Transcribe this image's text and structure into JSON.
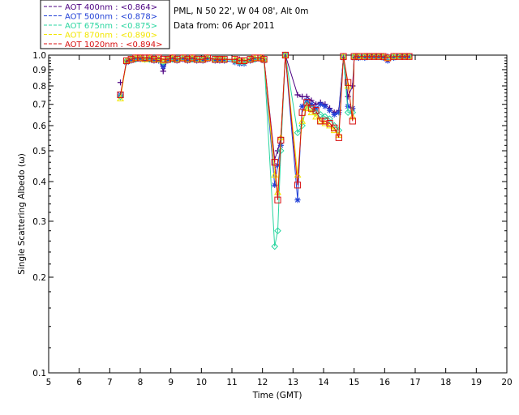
{
  "header": {
    "site_line": "PML, N 50 22', W 04 08', Alt 0m",
    "date_line": "Data from: 06 Apr 2011"
  },
  "legend": [
    {
      "label": "AOT  400nm : <0.864>",
      "color": "#4b0082",
      "marker": "plus"
    },
    {
      "label": "AOT  500nm : <0.878>",
      "color": "#1f3fd6",
      "marker": "asterisk"
    },
    {
      "label": "AOT  675nm : <0.875>",
      "color": "#2ad6a0",
      "marker": "diamond"
    },
    {
      "label": "AOT  870nm : <0.890>",
      "color": "#f2e600",
      "marker": "triangle"
    },
    {
      "label": "AOT 1020nm : <0.894>",
      "color": "#d81010",
      "marker": "square"
    }
  ],
  "chart_data": {
    "type": "line",
    "title": "",
    "xlabel": "Time (GMT)",
    "ylabel": "Single Scattering Albedo (ω)",
    "xlim": [
      5,
      20
    ],
    "ylim": [
      0.1,
      1.0
    ],
    "yscale": "log",
    "x_ticks": [
      "5",
      "6",
      "7",
      "8",
      "9",
      "10",
      "11",
      "12",
      "13",
      "14",
      "15",
      "16",
      "17",
      "18",
      "19",
      "20"
    ],
    "y_ticks": [
      "0.1",
      "0.2",
      "0.3",
      "0.4",
      "0.5",
      "0.6",
      "0.7",
      "0.8",
      "0.9",
      "1.0"
    ],
    "series": [
      {
        "name": "AOT  400nm : <0.864>",
        "color": "#4b0082",
        "x": [
          7.35,
          7.55,
          7.7,
          7.85,
          8.0,
          8.15,
          8.3,
          8.45,
          8.6,
          8.75,
          8.9,
          9.05,
          9.2,
          9.4,
          9.55,
          9.7,
          9.85,
          10.05,
          10.2,
          10.45,
          10.6,
          10.75,
          11.1,
          11.25,
          11.4,
          11.6,
          11.75,
          11.95,
          12.05,
          12.4,
          12.5,
          12.6,
          12.75,
          13.15,
          13.3,
          13.45,
          13.6,
          13.75,
          13.9,
          14.05,
          14.2,
          14.35,
          14.5,
          14.65,
          14.8,
          14.95,
          15.0,
          15.15,
          15.35,
          15.5,
          15.65,
          15.8,
          15.95,
          16.1,
          16.3,
          16.5,
          16.65,
          16.8
        ],
        "y": [
          0.82,
          0.96,
          0.97,
          0.98,
          0.98,
          0.97,
          0.98,
          0.97,
          0.97,
          0.89,
          0.97,
          0.98,
          0.97,
          0.98,
          0.97,
          0.98,
          0.97,
          0.97,
          0.98,
          0.97,
          0.97,
          0.97,
          0.97,
          0.97,
          0.96,
          0.97,
          0.98,
          0.98,
          0.97,
          0.47,
          0.5,
          0.55,
          1.0,
          0.75,
          0.74,
          0.74,
          0.72,
          0.7,
          0.71,
          0.7,
          0.68,
          0.66,
          0.67,
          0.98,
          0.74,
          0.8,
          0.98,
          0.98,
          0.99,
          0.99,
          0.99,
          0.99,
          0.99,
          0.99,
          0.99,
          0.99,
          0.99,
          0.99
        ],
        "gaps": [
          0
        ]
      },
      {
        "name": "AOT  500nm : <0.878>",
        "color": "#1f3fd6",
        "x": [
          7.35,
          7.55,
          7.7,
          7.85,
          8.0,
          8.15,
          8.3,
          8.45,
          8.6,
          8.75,
          8.9,
          9.05,
          9.2,
          9.4,
          9.55,
          9.7,
          9.85,
          10.05,
          10.2,
          10.45,
          10.6,
          10.75,
          11.1,
          11.25,
          11.4,
          11.6,
          11.75,
          11.95,
          12.05,
          12.4,
          12.5,
          12.6,
          12.75,
          13.15,
          13.3,
          13.45,
          13.6,
          13.75,
          13.9,
          14.05,
          14.2,
          14.35,
          14.5,
          14.65,
          14.8,
          14.95,
          15.0,
          15.15,
          15.35,
          15.5,
          15.65,
          15.8,
          15.95,
          16.1,
          16.3,
          16.5,
          16.65,
          16.8
        ],
        "y": [
          0.75,
          0.95,
          0.96,
          0.97,
          0.97,
          0.97,
          0.97,
          0.96,
          0.96,
          0.92,
          0.96,
          0.97,
          0.96,
          0.97,
          0.96,
          0.97,
          0.96,
          0.96,
          0.97,
          0.96,
          0.96,
          0.96,
          0.95,
          0.94,
          0.94,
          0.96,
          0.97,
          0.97,
          0.96,
          0.39,
          0.45,
          0.52,
          1.0,
          0.35,
          0.69,
          0.72,
          0.7,
          0.68,
          0.7,
          0.69,
          0.67,
          0.65,
          0.66,
          0.98,
          0.69,
          0.68,
          0.98,
          0.98,
          0.98,
          0.99,
          0.99,
          0.99,
          0.98,
          0.96,
          0.98,
          0.99,
          0.99,
          0.99
        ]
      },
      {
        "name": "AOT  675nm : <0.875>",
        "color": "#2ad6a0",
        "x": [
          7.35,
          7.55,
          7.7,
          7.85,
          8.0,
          8.15,
          8.3,
          8.45,
          8.6,
          8.75,
          8.9,
          9.05,
          9.2,
          9.4,
          9.55,
          9.7,
          9.85,
          10.05,
          10.2,
          10.45,
          10.6,
          10.75,
          11.1,
          11.25,
          11.4,
          11.6,
          11.75,
          11.95,
          12.05,
          12.4,
          12.5,
          12.6,
          12.75,
          13.15,
          13.3,
          13.45,
          13.6,
          13.75,
          13.9,
          14.05,
          14.2,
          14.35,
          14.5,
          14.65,
          14.8,
          14.95,
          15.0,
          15.15,
          15.35,
          15.5,
          15.65,
          15.8,
          15.95,
          16.1,
          16.3,
          16.5,
          16.65,
          16.8
        ],
        "y": [
          0.74,
          0.96,
          0.97,
          0.97,
          0.98,
          0.97,
          0.97,
          0.97,
          0.97,
          0.95,
          0.97,
          0.97,
          0.97,
          0.98,
          0.97,
          0.97,
          0.97,
          0.97,
          0.98,
          0.97,
          0.97,
          0.97,
          0.96,
          0.95,
          0.95,
          0.97,
          0.97,
          0.98,
          0.97,
          0.25,
          0.28,
          0.5,
          1.0,
          0.57,
          0.6,
          0.7,
          0.68,
          0.66,
          0.65,
          0.64,
          0.63,
          0.6,
          0.58,
          0.99,
          0.66,
          0.66,
          0.99,
          0.99,
          0.99,
          0.99,
          0.99,
          0.99,
          0.99,
          0.98,
          0.99,
          0.99,
          0.99,
          0.99
        ]
      },
      {
        "name": "AOT  870nm : <0.890>",
        "color": "#f2e600",
        "x": [
          7.35,
          7.55,
          7.7,
          7.85,
          8.0,
          8.15,
          8.3,
          8.45,
          8.6,
          8.75,
          8.9,
          9.05,
          9.2,
          9.4,
          9.55,
          9.7,
          9.85,
          10.05,
          10.2,
          10.45,
          10.6,
          10.75,
          11.1,
          11.25,
          11.4,
          11.6,
          11.75,
          11.95,
          12.05,
          12.4,
          12.5,
          12.6,
          12.75,
          13.15,
          13.3,
          13.45,
          13.6,
          13.75,
          13.9,
          14.05,
          14.2,
          14.35,
          14.5,
          14.65,
          14.8,
          14.95,
          15.0,
          15.15,
          15.35,
          15.5,
          15.65,
          15.8,
          15.95,
          16.1,
          16.3,
          16.5,
          16.65,
          16.8
        ],
        "y": [
          0.73,
          0.96,
          0.97,
          0.98,
          0.98,
          0.97,
          0.98,
          0.97,
          0.97,
          0.96,
          0.97,
          0.98,
          0.97,
          0.98,
          0.97,
          0.98,
          0.97,
          0.97,
          0.98,
          0.97,
          0.97,
          0.97,
          0.97,
          0.96,
          0.96,
          0.97,
          0.98,
          0.98,
          0.97,
          0.42,
          0.37,
          0.55,
          1.0,
          0.42,
          0.62,
          0.68,
          0.66,
          0.64,
          0.62,
          0.61,
          0.6,
          0.58,
          0.56,
          0.99,
          0.8,
          0.64,
          0.99,
          0.99,
          0.99,
          0.99,
          0.99,
          0.99,
          0.99,
          0.98,
          0.99,
          0.99,
          0.99,
          0.99
        ]
      },
      {
        "name": "AOT 1020nm : <0.894>",
        "color": "#d81010",
        "x": [
          7.35,
          7.55,
          7.7,
          7.85,
          8.0,
          8.15,
          8.3,
          8.45,
          8.6,
          8.75,
          8.9,
          9.05,
          9.2,
          9.4,
          9.55,
          9.7,
          9.85,
          10.05,
          10.2,
          10.45,
          10.6,
          10.75,
          11.1,
          11.25,
          11.4,
          11.6,
          11.75,
          11.95,
          12.05,
          12.4,
          12.5,
          12.6,
          12.75,
          13.15,
          13.3,
          13.45,
          13.6,
          13.75,
          13.9,
          14.05,
          14.2,
          14.35,
          14.5,
          14.65,
          14.8,
          14.95,
          15.0,
          15.15,
          15.35,
          15.5,
          15.65,
          15.8,
          15.95,
          16.1,
          16.3,
          16.5,
          16.65,
          16.8
        ],
        "y": [
          0.75,
          0.96,
          0.97,
          0.98,
          0.98,
          0.98,
          0.98,
          0.97,
          0.98,
          0.97,
          0.97,
          0.98,
          0.97,
          0.98,
          0.97,
          0.98,
          0.97,
          0.97,
          0.98,
          0.97,
          0.97,
          0.97,
          0.97,
          0.96,
          0.96,
          0.97,
          0.98,
          0.98,
          0.97,
          0.46,
          0.35,
          0.54,
          1.0,
          0.39,
          0.66,
          0.71,
          0.68,
          0.67,
          0.62,
          0.62,
          0.61,
          0.59,
          0.55,
          0.99,
          0.82,
          0.62,
          0.99,
          0.99,
          0.99,
          0.99,
          0.99,
          0.99,
          0.99,
          0.98,
          0.99,
          0.99,
          0.99,
          0.99
        ]
      }
    ]
  }
}
